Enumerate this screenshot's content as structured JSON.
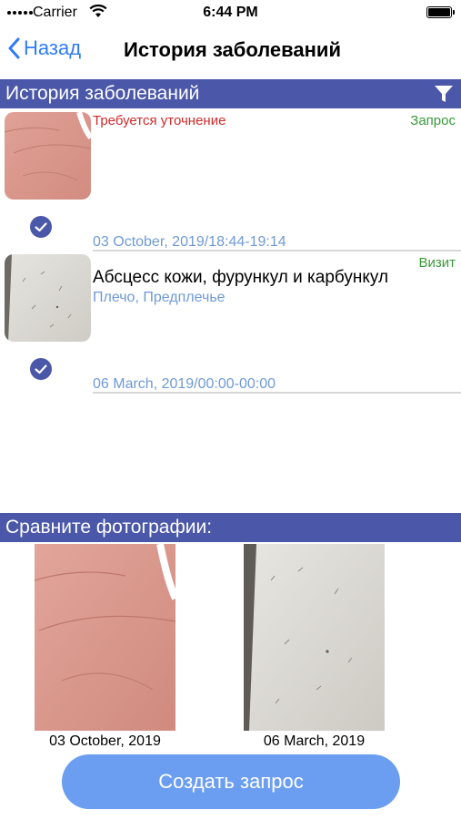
{
  "status_bar": {
    "carrier": "Carrier",
    "time": "6:44 PM"
  },
  "nav": {
    "back_label": "Назад",
    "title": "История заболеваний"
  },
  "history_section": {
    "title": "История заболеваний"
  },
  "records": [
    {
      "warning": "Требуется уточнение",
      "type": "Запрос",
      "diagnosis": "",
      "location": "",
      "date": "03 October, 2019/18:44-19:14"
    },
    {
      "warning": "",
      "type": "Визит",
      "diagnosis": "Абсцесс кожи, фурункул и карбункул",
      "location": "Плечо, Предплечье",
      "date": "06 March, 2019/00:00-00:00"
    }
  ],
  "compare_section": {
    "title": "Сравните фотографии:"
  },
  "compare_photos": [
    {
      "date": "03 October, 2019"
    },
    {
      "date": "06 March, 2019"
    }
  ],
  "create_button": {
    "label": "Создать запрос"
  },
  "colors": {
    "header_bg": "#4b57a8",
    "accent": "#2f7cf6",
    "warning": "#d02a2a",
    "type": "#3a9a3a",
    "subtext": "#6f9ad6",
    "button": "#6b9ef0"
  },
  "icons": [
    "wifi-icon",
    "battery-icon",
    "chevron-left-icon",
    "filter-icon",
    "check-icon"
  ]
}
